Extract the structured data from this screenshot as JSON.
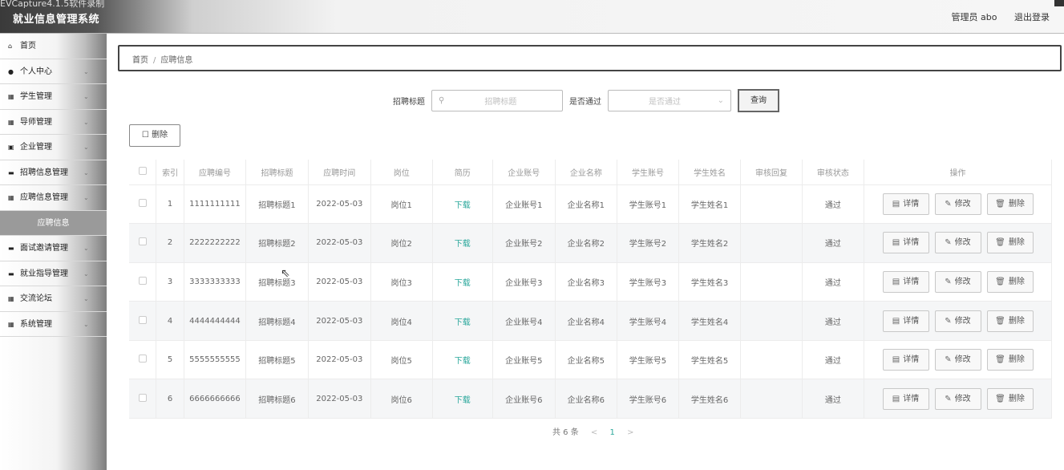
{
  "window": {
    "capture_title": "EVCapture4.1.5软件录制"
  },
  "app": {
    "title": "就业信息管理系统"
  },
  "header": {
    "user_label": "管理员 abo",
    "logout_label": "退出登录"
  },
  "sidebar": {
    "items": [
      {
        "label": "首页",
        "icon": "home-icon",
        "glyph": "⌂",
        "chevron": ""
      },
      {
        "label": "个人中心",
        "icon": "user-icon",
        "glyph": "●",
        "chevron": "⌄"
      },
      {
        "label": "学生管理",
        "icon": "grid-icon",
        "glyph": "▦",
        "chevron": "⌄"
      },
      {
        "label": "导师管理",
        "icon": "grid-icon",
        "glyph": "▦",
        "chevron": "⌄"
      },
      {
        "label": "企业管理",
        "icon": "building-icon",
        "glyph": "▣",
        "chevron": "⌄"
      },
      {
        "label": "招聘信息管理",
        "icon": "monitor-icon",
        "glyph": "▬",
        "chevron": "⌄"
      },
      {
        "label": "应聘信息管理",
        "icon": "grid-icon",
        "glyph": "▦",
        "chevron": "⌄"
      },
      {
        "label": "应聘信息",
        "icon": "",
        "glyph": "",
        "chevron": ""
      },
      {
        "label": "面试邀请管理",
        "icon": "monitor-icon",
        "glyph": "▬",
        "chevron": "⌄"
      },
      {
        "label": "就业指导管理",
        "icon": "monitor-icon",
        "glyph": "▬",
        "chevron": "⌄"
      },
      {
        "label": "交流论坛",
        "icon": "grid-icon",
        "glyph": "▦",
        "chevron": "⌄"
      },
      {
        "label": "系统管理",
        "icon": "grid-icon",
        "glyph": "▦",
        "chevron": "⌄"
      }
    ]
  },
  "breadcrumb": {
    "home": "首页",
    "separator": "/",
    "current": "应聘信息"
  },
  "search": {
    "title_label": "招聘标题",
    "title_placeholder": "招聘标题",
    "review_label": "是否通过",
    "review_placeholder": "是否通过",
    "query_button": "查询"
  },
  "toolbar": {
    "delete_label": "删除"
  },
  "table": {
    "columns": [
      "索引",
      "应聘编号",
      "招聘标题",
      "应聘时间",
      "岗位",
      "简历",
      "企业账号",
      "企业名称",
      "学生账号",
      "学生姓名",
      "审核回复",
      "审核状态",
      "操作"
    ],
    "rows": [
      {
        "index": "1",
        "code": "1111111111",
        "title": "招聘标题1",
        "time": "2022-05-03",
        "post": "岗位1",
        "resume": "下载",
        "ent_account": "企业账号1",
        "ent_name": "企业名称1",
        "stu_account": "学生账号1",
        "stu_name": "学生姓名1",
        "reply": "",
        "status": "通过"
      },
      {
        "index": "2",
        "code": "2222222222",
        "title": "招聘标题2",
        "time": "2022-05-03",
        "post": "岗位2",
        "resume": "下载",
        "ent_account": "企业账号2",
        "ent_name": "企业名称2",
        "stu_account": "学生账号2",
        "stu_name": "学生姓名2",
        "reply": "",
        "status": "通过"
      },
      {
        "index": "3",
        "code": "3333333333",
        "title": "招聘标题3",
        "time": "2022-05-03",
        "post": "岗位3",
        "resume": "下载",
        "ent_account": "企业账号3",
        "ent_name": "企业名称3",
        "stu_account": "学生账号3",
        "stu_name": "学生姓名3",
        "reply": "",
        "status": "通过"
      },
      {
        "index": "4",
        "code": "4444444444",
        "title": "招聘标题4",
        "time": "2022-05-03",
        "post": "岗位4",
        "resume": "下载",
        "ent_account": "企业账号4",
        "ent_name": "企业名称4",
        "stu_account": "学生账号4",
        "stu_name": "学生姓名4",
        "reply": "",
        "status": "通过"
      },
      {
        "index": "5",
        "code": "5555555555",
        "title": "招聘标题5",
        "time": "2022-05-03",
        "post": "岗位5",
        "resume": "下载",
        "ent_account": "企业账号5",
        "ent_name": "企业名称5",
        "stu_account": "学生账号5",
        "stu_name": "学生姓名5",
        "reply": "",
        "status": "通过"
      },
      {
        "index": "6",
        "code": "6666666666",
        "title": "招聘标题6",
        "time": "2022-05-03",
        "post": "岗位6",
        "resume": "下载",
        "ent_account": "企业账号6",
        "ent_name": "企业名称6",
        "stu_account": "学生账号6",
        "stu_name": "学生姓名6",
        "reply": "",
        "status": "通过"
      }
    ],
    "actions": {
      "detail": "详情",
      "edit": "修改",
      "delete": "删除"
    }
  },
  "pagination": {
    "total": "共 6 条",
    "current_page": "1",
    "prev": "<",
    "next": ">"
  },
  "colors": {
    "accent": "#2aa79b",
    "active_menu": "#9a9a9a"
  }
}
